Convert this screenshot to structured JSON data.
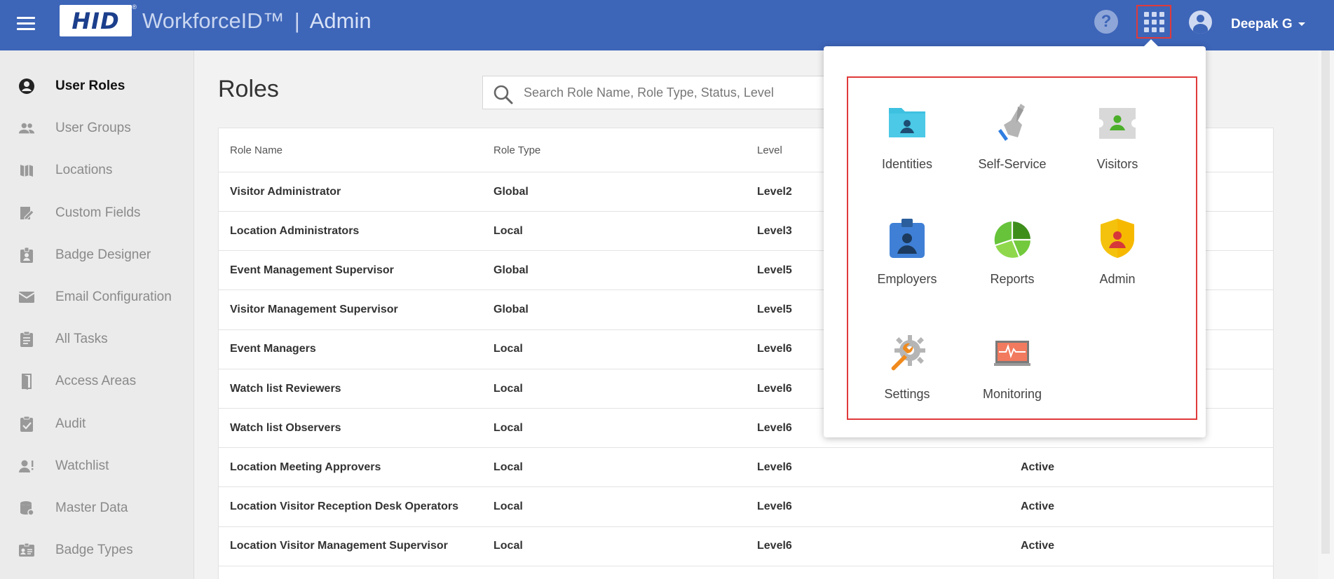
{
  "header": {
    "logo_text": "HID",
    "logo_mark": "®",
    "product": "WorkforceID™",
    "separator": "|",
    "section": "Admin",
    "help": "?",
    "user": "Deepak G",
    "bg_color": "#3d65b8"
  },
  "sidebar": {
    "items": [
      {
        "label": "User Roles",
        "icon": "account-circle-icon",
        "active": true
      },
      {
        "label": "User Groups",
        "icon": "group-icon"
      },
      {
        "label": "Locations",
        "icon": "map-icon"
      },
      {
        "label": "Custom Fields",
        "icon": "edit-fields-icon"
      },
      {
        "label": "Badge Designer",
        "icon": "badge-icon"
      },
      {
        "label": "Email Configuration",
        "icon": "mail-icon"
      },
      {
        "label": "All Tasks",
        "icon": "clipboard-icon"
      },
      {
        "label": "Access Areas",
        "icon": "door-icon"
      },
      {
        "label": "Audit",
        "icon": "clipboard-check-icon"
      },
      {
        "label": "Watchlist",
        "icon": "person-alert-icon"
      },
      {
        "label": "Master Data",
        "icon": "database-icon"
      },
      {
        "label": "Badge Types",
        "icon": "id-card-icon"
      }
    ]
  },
  "main": {
    "title": "Roles",
    "search_placeholder": "Search Role Name, Role Type, Status, Level"
  },
  "table": {
    "columns": [
      "Role Name",
      "Role Type",
      "Level",
      ""
    ],
    "rows": [
      [
        "Visitor Administrator",
        "Global",
        "Level2",
        ""
      ],
      [
        "Location Administrators",
        "Local",
        "Level3",
        ""
      ],
      [
        "Event Management Supervisor",
        "Global",
        "Level5",
        ""
      ],
      [
        "Visitor Management Supervisor",
        "Global",
        "Level5",
        ""
      ],
      [
        "Event Managers",
        "Local",
        "Level6",
        ""
      ],
      [
        "Watch list Reviewers",
        "Local",
        "Level6",
        ""
      ],
      [
        "Watch list Observers",
        "Local",
        "Level6",
        ""
      ],
      [
        "Location Meeting Approvers",
        "Local",
        "Level6",
        "Active"
      ],
      [
        "Location Visitor Reception Desk Operators",
        "Local",
        "Level6",
        "Active"
      ],
      [
        "Location Visitor Management Supervisor",
        "Local",
        "Level6",
        "Active"
      ]
    ]
  },
  "apps_menu": {
    "items": [
      {
        "label": "Identities",
        "icon": "folder-person-icon"
      },
      {
        "label": "Self-Service",
        "icon": "touch-hand-icon"
      },
      {
        "label": "Visitors",
        "icon": "visitor-ticket-icon"
      },
      {
        "label": "Employers",
        "icon": "employee-badge-icon"
      },
      {
        "label": "Reports",
        "icon": "pie-chart-icon"
      },
      {
        "label": "Admin",
        "icon": "shield-person-icon"
      },
      {
        "label": "Settings",
        "icon": "wrench-gear-icon"
      },
      {
        "label": "Monitoring",
        "icon": "monitor-pulse-icon"
      }
    ]
  }
}
